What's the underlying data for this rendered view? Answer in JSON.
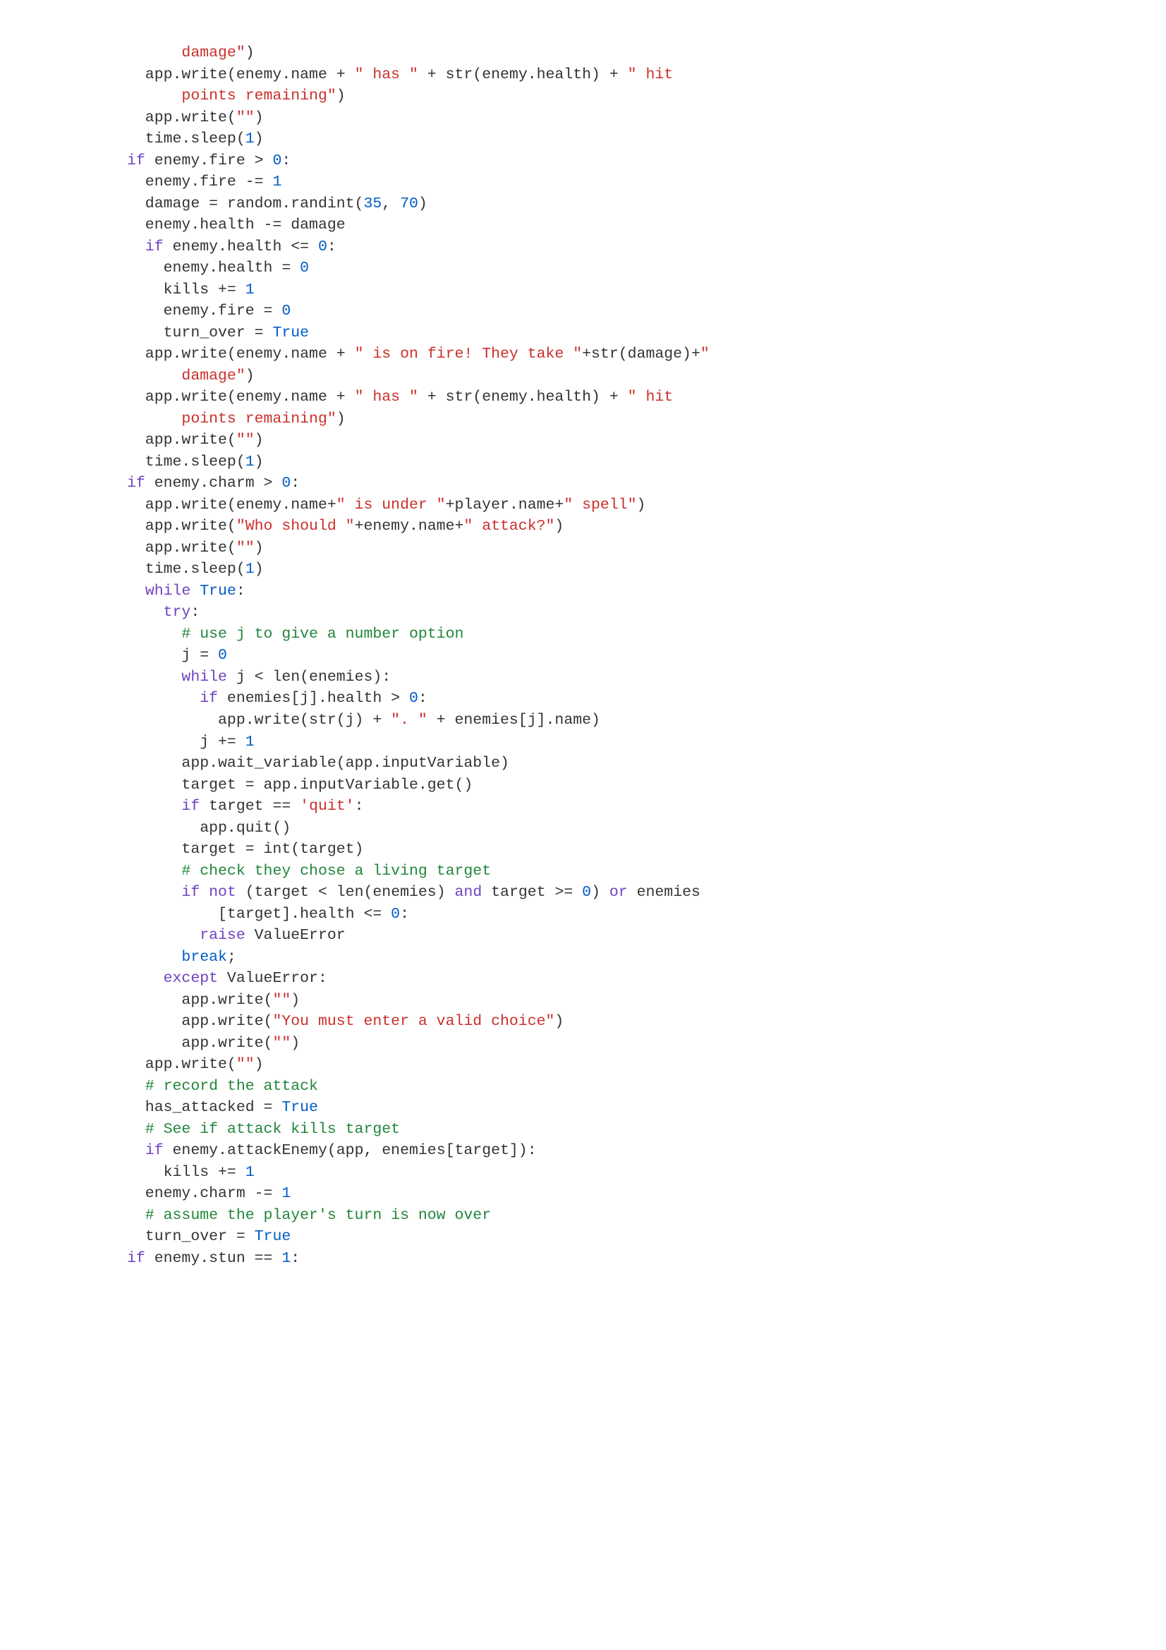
{
  "code_lines": [
    [
      [
        "str",
        "damage\""
      ],
      [
        "",
        ")"
      ]
    ],
    [
      [
        "",
        "  app.write(enemy.name + "
      ],
      [
        "str",
        "\" has \""
      ],
      [
        "",
        " + str(enemy.health) + "
      ],
      [
        "str",
        "\" hit"
      ]
    ],
    [
      [
        "str",
        "      points remaining\""
      ],
      [
        "",
        ")"
      ]
    ],
    [
      [
        "",
        "  app.write("
      ],
      [
        "str",
        "\"\""
      ],
      [
        "",
        ")"
      ]
    ],
    [
      [
        "",
        "  time.sleep("
      ],
      [
        "num",
        "1"
      ],
      [
        "",
        ")"
      ]
    ],
    [
      [
        "",
        ""
      ]
    ],
    [
      [
        "kw",
        "if"
      ],
      [
        "",
        " enemy.fire > "
      ],
      [
        "num",
        "0"
      ],
      [
        "",
        ":"
      ]
    ],
    [
      [
        "",
        "  enemy.fire -= "
      ],
      [
        "num",
        "1"
      ]
    ],
    [
      [
        "",
        "  damage = random.randint("
      ],
      [
        "num",
        "35"
      ],
      [
        "",
        ", "
      ],
      [
        "num",
        "70"
      ],
      [
        "",
        ")"
      ]
    ],
    [
      [
        "",
        "  enemy.health -= damage"
      ]
    ],
    [
      [
        "",
        "  "
      ],
      [
        "kw",
        "if"
      ],
      [
        "",
        " enemy.health <= "
      ],
      [
        "num",
        "0"
      ],
      [
        "",
        ":"
      ]
    ],
    [
      [
        "",
        "    enemy.health = "
      ],
      [
        "num",
        "0"
      ]
    ],
    [
      [
        "",
        "    kills += "
      ],
      [
        "num",
        "1"
      ]
    ],
    [
      [
        "",
        "    enemy.fire = "
      ],
      [
        "num",
        "0"
      ]
    ],
    [
      [
        "",
        "    turn_over = "
      ],
      [
        "kw2",
        "True"
      ]
    ],
    [
      [
        "",
        "  app.write(enemy.name + "
      ],
      [
        "str",
        "\" is on fire! They take \""
      ],
      [
        "",
        "+str(damage)+"
      ],
      [
        "str",
        "\""
      ]
    ],
    [
      [
        "str",
        "      damage\""
      ],
      [
        "",
        ")"
      ]
    ],
    [
      [
        "",
        "  app.write(enemy.name + "
      ],
      [
        "str",
        "\" has \""
      ],
      [
        "",
        " + str(enemy.health) + "
      ],
      [
        "str",
        "\" hit"
      ]
    ],
    [
      [
        "str",
        "      points remaining\""
      ],
      [
        "",
        ")"
      ]
    ],
    [
      [
        "",
        "  app.write("
      ],
      [
        "str",
        "\"\""
      ],
      [
        "",
        ")"
      ]
    ],
    [
      [
        "",
        "  time.sleep("
      ],
      [
        "num",
        "1"
      ],
      [
        "",
        ")"
      ]
    ],
    [
      [
        "",
        ""
      ]
    ],
    [
      [
        "kw",
        "if"
      ],
      [
        "",
        " enemy.charm > "
      ],
      [
        "num",
        "0"
      ],
      [
        "",
        ":"
      ]
    ],
    [
      [
        "",
        "  app.write(enemy.name+"
      ],
      [
        "str",
        "\" is under \""
      ],
      [
        "",
        "+player.name+"
      ],
      [
        "str",
        "\" spell\""
      ],
      [
        "",
        ")"
      ]
    ],
    [
      [
        "",
        "  app.write("
      ],
      [
        "str",
        "\"Who should \""
      ],
      [
        "",
        "+enemy.name+"
      ],
      [
        "str",
        "\" attack?\""
      ],
      [
        "",
        ")"
      ]
    ],
    [
      [
        "",
        "  app.write("
      ],
      [
        "str",
        "\"\""
      ],
      [
        "",
        ")"
      ]
    ],
    [
      [
        "",
        "  time.sleep("
      ],
      [
        "num",
        "1"
      ],
      [
        "",
        ")"
      ]
    ],
    [
      [
        "",
        "  "
      ],
      [
        "kw",
        "while"
      ],
      [
        "",
        " "
      ],
      [
        "kw2",
        "True"
      ],
      [
        "",
        ":"
      ]
    ],
    [
      [
        "",
        "    "
      ],
      [
        "kw",
        "try"
      ],
      [
        "",
        ":"
      ]
    ],
    [
      [
        "",
        "      "
      ],
      [
        "com",
        "# use j to give a number option"
      ]
    ],
    [
      [
        "",
        "      j = "
      ],
      [
        "num",
        "0"
      ]
    ],
    [
      [
        "",
        "      "
      ],
      [
        "kw",
        "while"
      ],
      [
        "",
        " j < len(enemies):"
      ]
    ],
    [
      [
        "",
        "        "
      ],
      [
        "kw",
        "if"
      ],
      [
        "",
        " enemies[j].health > "
      ],
      [
        "num",
        "0"
      ],
      [
        "",
        ":"
      ]
    ],
    [
      [
        "",
        "          app.write(str(j) + "
      ],
      [
        "str",
        "\". \""
      ],
      [
        "",
        " + enemies[j].name)"
      ]
    ],
    [
      [
        "",
        "        j += "
      ],
      [
        "num",
        "1"
      ]
    ],
    [
      [
        "",
        "      app.wait_variable(app.inputVariable)"
      ]
    ],
    [
      [
        "",
        "      target = app.inputVariable.get()"
      ]
    ],
    [
      [
        "",
        "      "
      ],
      [
        "kw",
        "if"
      ],
      [
        "",
        " target == "
      ],
      [
        "str",
        "'quit'"
      ],
      [
        "",
        ":"
      ]
    ],
    [
      [
        "",
        "        app.quit()"
      ]
    ],
    [
      [
        "",
        "      target = int(target)"
      ]
    ],
    [
      [
        "",
        "      "
      ],
      [
        "com",
        "# check they chose a living target"
      ]
    ],
    [
      [
        "",
        "      "
      ],
      [
        "kw",
        "if"
      ],
      [
        "",
        " "
      ],
      [
        "kw",
        "not"
      ],
      [
        "",
        " (target < len(enemies) "
      ],
      [
        "kw",
        "and"
      ],
      [
        "",
        " target >= "
      ],
      [
        "num",
        "0"
      ],
      [
        "",
        ") "
      ],
      [
        "kw",
        "or"
      ],
      [
        "",
        " enemies"
      ]
    ],
    [
      [
        "",
        "          [target].health <= "
      ],
      [
        "num",
        "0"
      ],
      [
        "",
        ":"
      ]
    ],
    [
      [
        "",
        "        "
      ],
      [
        "kw",
        "raise"
      ],
      [
        "",
        " ValueError"
      ]
    ],
    [
      [
        "",
        "      "
      ],
      [
        "kw2",
        "break"
      ],
      [
        "",
        ";"
      ]
    ],
    [
      [
        "",
        "    "
      ],
      [
        "kw",
        "except"
      ],
      [
        "",
        " ValueError:"
      ]
    ],
    [
      [
        "",
        "      app.write("
      ],
      [
        "str",
        "\"\""
      ],
      [
        "",
        ")"
      ]
    ],
    [
      [
        "",
        "      app.write("
      ],
      [
        "str",
        "\"You must enter a valid choice\""
      ],
      [
        "",
        ")"
      ]
    ],
    [
      [
        "",
        "      app.write("
      ],
      [
        "str",
        "\"\""
      ],
      [
        "",
        ")"
      ]
    ],
    [
      [
        "",
        "  app.write("
      ],
      [
        "str",
        "\"\""
      ],
      [
        "",
        ")"
      ]
    ],
    [
      [
        "",
        "  "
      ],
      [
        "com",
        "# record the attack"
      ]
    ],
    [
      [
        "",
        "  has_attacked = "
      ],
      [
        "kw2",
        "True"
      ]
    ],
    [
      [
        "",
        "  "
      ],
      [
        "com",
        "# See if attack kills target"
      ]
    ],
    [
      [
        "",
        "  "
      ],
      [
        "kw",
        "if"
      ],
      [
        "",
        " enemy.attackEnemy(app, enemies[target]):"
      ]
    ],
    [
      [
        "",
        "    kills += "
      ],
      [
        "num",
        "1"
      ]
    ],
    [
      [
        "",
        "  enemy.charm -= "
      ],
      [
        "num",
        "1"
      ]
    ],
    [
      [
        "",
        "  "
      ],
      [
        "com",
        "# assume the player's turn is now over"
      ]
    ],
    [
      [
        "",
        "  turn_over = "
      ],
      [
        "kw2",
        "True"
      ]
    ],
    [
      [
        "",
        ""
      ]
    ],
    [
      [
        "kw",
        "if"
      ],
      [
        "",
        " enemy.stun == "
      ],
      [
        "num",
        "1"
      ],
      [
        "",
        ":"
      ]
    ]
  ],
  "indent_prefix": "      "
}
